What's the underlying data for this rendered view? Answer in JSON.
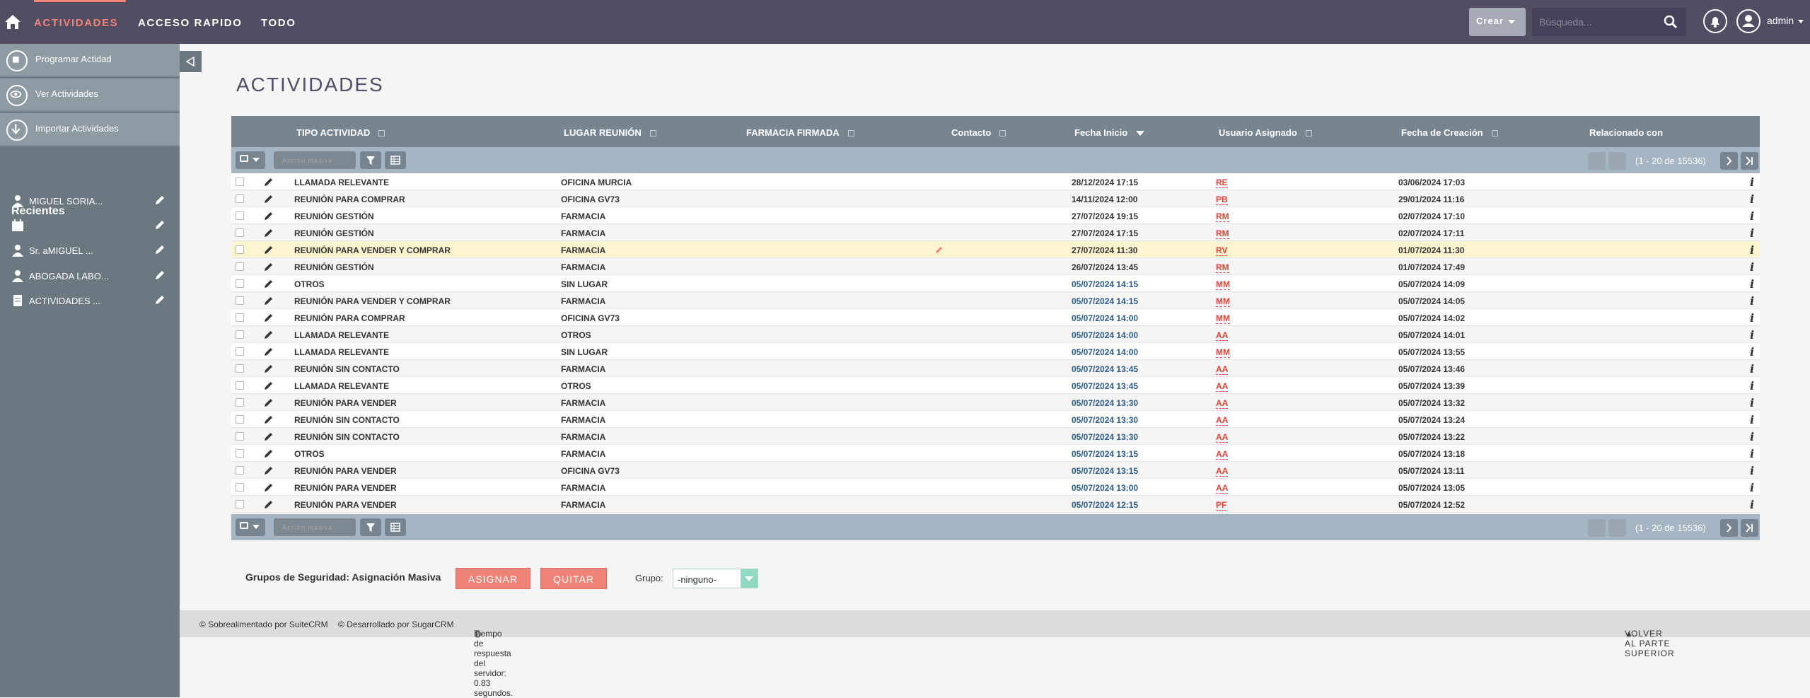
{
  "nav": {
    "tabs": [
      "ACTIVIDADES",
      "ACCESO RAPIDO",
      "TODO"
    ],
    "crear": "Crear",
    "search_placeholder": "Búsqueda...",
    "user": "admin"
  },
  "sidebar": {
    "actions": [
      "Programar Actidad",
      "Ver Actividades",
      "Importar Actividades"
    ],
    "recent_title": "Recientes",
    "recent": [
      "MIGUEL SORIA...",
      "",
      "Sr. aMIGUEL ...",
      "ABOGADA LABO...",
      "ACTIVIDADES ..."
    ]
  },
  "page_title": "ACTIVIDADES",
  "table": {
    "headers": [
      "TIPO ACTIVIDAD",
      "LUGAR REUNIÓN",
      "FARMACIA FIRMADA",
      "Contacto",
      "Fecha Inicio",
      "Usuario Asignado",
      "Fecha de Creación",
      "Relacionado con"
    ],
    "mass_action": "Acción masiva",
    "pagination": "(1 - 20 de 15536)",
    "rows": [
      {
        "tipo": "LLAMADA RELEVANTE",
        "lugar": "OFICINA MURCIA",
        "inicio": "28/12/2024 17:15",
        "blue": false,
        "usuario": "RE",
        "creacion": "03/06/2024 17:03"
      },
      {
        "tipo": "REUNIÓN PARA COMPRAR",
        "lugar": "OFICINA GV73",
        "inicio": "14/11/2024 12:00",
        "blue": false,
        "usuario": "PB",
        "creacion": "29/01/2024 11:16"
      },
      {
        "tipo": "REUNIÓN GESTIÓN",
        "lugar": "FARMACIA",
        "inicio": "27/07/2024 19:15",
        "blue": false,
        "usuario": "RM",
        "creacion": "02/07/2024 17:10"
      },
      {
        "tipo": "REUNIÓN GESTIÓN",
        "lugar": "FARMACIA",
        "inicio": "27/07/2024 17:15",
        "blue": false,
        "usuario": "RM",
        "creacion": "02/07/2024 17:11"
      },
      {
        "tipo": "REUNIÓN PARA VENDER Y COMPRAR",
        "lugar": "FARMACIA",
        "inicio": "27/07/2024 11:30",
        "blue": false,
        "usuario": "RV",
        "creacion": "01/07/2024 11:30"
      },
      {
        "tipo": "REUNIÓN GESTIÓN",
        "lugar": "FARMACIA",
        "inicio": "26/07/2024 13:45",
        "blue": false,
        "usuario": "RM",
        "creacion": "01/07/2024 17:49"
      },
      {
        "tipo": "OTROS",
        "lugar": "SIN LUGAR",
        "inicio": "05/07/2024 14:15",
        "blue": true,
        "usuario": "MM",
        "creacion": "05/07/2024 14:09"
      },
      {
        "tipo": "REUNIÓN PARA VENDER Y COMPRAR",
        "lugar": "FARMACIA",
        "inicio": "05/07/2024 14:15",
        "blue": true,
        "usuario": "MM",
        "creacion": "05/07/2024 14:05"
      },
      {
        "tipo": "REUNIÓN PARA COMPRAR",
        "lugar": "OFICINA GV73",
        "inicio": "05/07/2024 14:00",
        "blue": true,
        "usuario": "MM",
        "creacion": "05/07/2024 14:02"
      },
      {
        "tipo": "LLAMADA RELEVANTE",
        "lugar": "OTROS",
        "inicio": "05/07/2024 14:00",
        "blue": true,
        "usuario": "AA",
        "creacion": "05/07/2024 14:01"
      },
      {
        "tipo": "LLAMADA RELEVANTE",
        "lugar": "SIN LUGAR",
        "inicio": "05/07/2024 14:00",
        "blue": true,
        "usuario": "MM",
        "creacion": "05/07/2024 13:55"
      },
      {
        "tipo": "REUNIÓN SIN CONTACTO",
        "lugar": "FARMACIA",
        "inicio": "05/07/2024 13:45",
        "blue": true,
        "usuario": "AA",
        "creacion": "05/07/2024 13:46"
      },
      {
        "tipo": "LLAMADA RELEVANTE",
        "lugar": "OTROS",
        "inicio": "05/07/2024 13:45",
        "blue": true,
        "usuario": "AA",
        "creacion": "05/07/2024 13:39"
      },
      {
        "tipo": "REUNIÓN PARA VENDER",
        "lugar": "FARMACIA",
        "inicio": "05/07/2024 13:30",
        "blue": true,
        "usuario": "AA",
        "creacion": "05/07/2024 13:32"
      },
      {
        "tipo": "REUNIÓN SIN CONTACTO",
        "lugar": "FARMACIA",
        "inicio": "05/07/2024 13:30",
        "blue": true,
        "usuario": "AA",
        "creacion": "05/07/2024 13:24"
      },
      {
        "tipo": "REUNIÓN SIN CONTACTO",
        "lugar": "FARMACIA",
        "inicio": "05/07/2024 13:30",
        "blue": true,
        "usuario": "AA",
        "creacion": "05/07/2024 13:22"
      },
      {
        "tipo": "OTROS",
        "lugar": "FARMACIA",
        "inicio": "05/07/2024 13:15",
        "blue": true,
        "usuario": "AA",
        "creacion": "05/07/2024 13:18"
      },
      {
        "tipo": "REUNIÓN PARA VENDER",
        "lugar": "OFICINA GV73",
        "inicio": "05/07/2024 13:15",
        "blue": true,
        "usuario": "AA",
        "creacion": "05/07/2024 13:11"
      },
      {
        "tipo": "REUNIÓN PARA VENDER",
        "lugar": "FARMACIA",
        "inicio": "05/07/2024 13:00",
        "blue": true,
        "usuario": "AA",
        "creacion": "05/07/2024 13:05"
      },
      {
        "tipo": "REUNIÓN PARA VENDER",
        "lugar": "FARMACIA",
        "inicio": "05/07/2024 12:15",
        "blue": true,
        "usuario": "PF",
        "creacion": "05/07/2024 12:52"
      }
    ],
    "highlight_row": 4
  },
  "security": {
    "label": "Grupos de Seguridad: Asignación Masiva",
    "assign": "ASIGNAR",
    "remove": "QUITAR",
    "group_label": "Grupo:",
    "group_value": "-ninguno-"
  },
  "footer": {
    "suite": "© Sobrealimentado por SuiteCRM",
    "sugar": "© Desarrollado por SugarCRM",
    "response": "Tiempo de respuesta del servidor: 0.83 segundos.",
    "top": "VOLVER AL PARTE SUPERIOR"
  },
  "icons": {
    "home": "home-icon",
    "search": "search-icon",
    "bell": "bell-icon",
    "user": "user-icon",
    "edit": "pencil-icon",
    "info": "info-icon",
    "filter": "filter-icon",
    "columns": "columns-icon"
  },
  "colors": {
    "accent": "#f08377",
    "topbar": "#534d64",
    "header": "#778591",
    "user_link": "#e0433b",
    "date_blue": "#2a5c8a"
  }
}
